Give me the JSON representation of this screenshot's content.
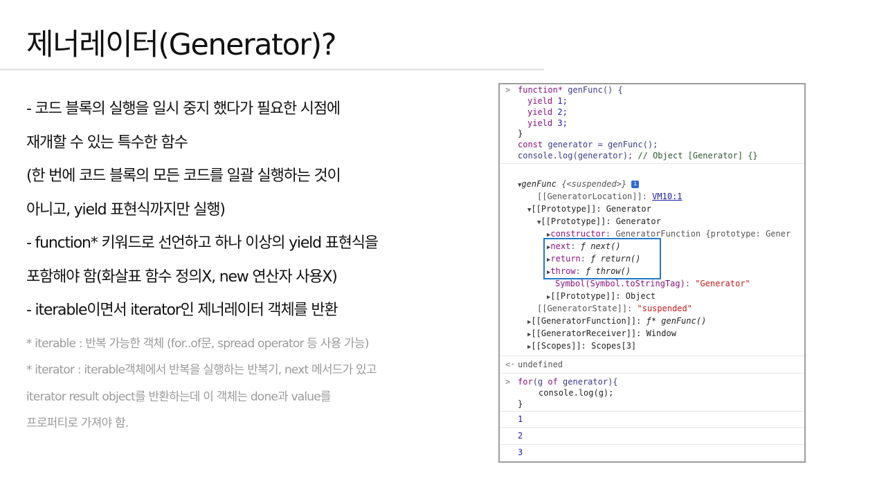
{
  "title": "제너레이터(Generator)?",
  "bullets": [
    "- 코드 블록의 실행을 일시 중지 했다가 필요한 시점에",
    "재개할 수 있는 특수한 함수",
    "(한 번에 코드 블록의 모든 코드를 일괄 실행하는 것이",
    "아니고, yield 표현식까지만 실행)",
    "- function* 키워드로 선언하고 하나 이상의 yield 표현식을",
    "포함해야 함(화살표 함수 정의X, new 연산자 사용X)",
    "- iterable이면서 iterator인 제너레이터 객체를 반환"
  ],
  "notes": [
    "* iterable : 반복 가능한 객체 (for..of문, spread operator 등 사용 가능)",
    "* iterator : iterable객체에서 반복을 실행하는 반복기, next 메서드가 있고",
    "iterator result object를 반환하는데 이 객체는 done과 value를",
    "프로퍼티로 가져야 함."
  ],
  "console": {
    "prompt": ">",
    "result_marker": "<·",
    "code1": {
      "l1_kw": "function*",
      "l1_rest": " genFunc() {",
      "l2_kw": "yield",
      "l2_num": " 1;",
      "l3_kw": "yield",
      "l3_num": " 2;",
      "l4_kw": "yield",
      "l4_num": " 3;",
      "l5": "}",
      "l6_kw": "const",
      "l6_rest": " generator = genFunc();",
      "l7_code": "console.log(generator); ",
      "l7_comment": "// Object [Generator] {}"
    },
    "tree": {
      "root_name": "genFunc",
      "root_state": " {<suspended>}",
      "info": "i",
      "loc_key": "[[GeneratorLocation]]: ",
      "loc_val": "VM10:1",
      "proto1": "[[Prototype]]: Generator",
      "proto2": "[[Prototype]]: Generator",
      "ctor_key": "constructor",
      "ctor_val": ": GeneratorFunction {prototype: Gener",
      "next_key": "next",
      "next_val": "next()",
      "return_key": "return",
      "return_val": "return()",
      "throw_key": "throw",
      "throw_val": "throw()",
      "f_glyph": "ƒ",
      "sym_key": "Symbol(Symbol.toStringTag)",
      "sym_val": "\"Generator\"",
      "proto3": "[[Prototype]]: Object",
      "state_key": "[[GeneratorState]]: ",
      "state_val": "\"suspended\"",
      "func_key": "[[GeneratorFunction]]: ",
      "func_val": "ƒ* genFunc()",
      "recv": "[[GeneratorReceiver]]: Window",
      "scopes": "[[Scopes]]: Scopes[3]"
    },
    "undefined_text": "undefined",
    "code2": {
      "l1_kw": "for",
      "l1_rest": "(g ",
      "l1_kw2": "of",
      "l1_rest2": " generator){",
      "l2": "console.log(g);",
      "l3": "}"
    },
    "outputs": [
      "1",
      "2",
      "3"
    ]
  }
}
